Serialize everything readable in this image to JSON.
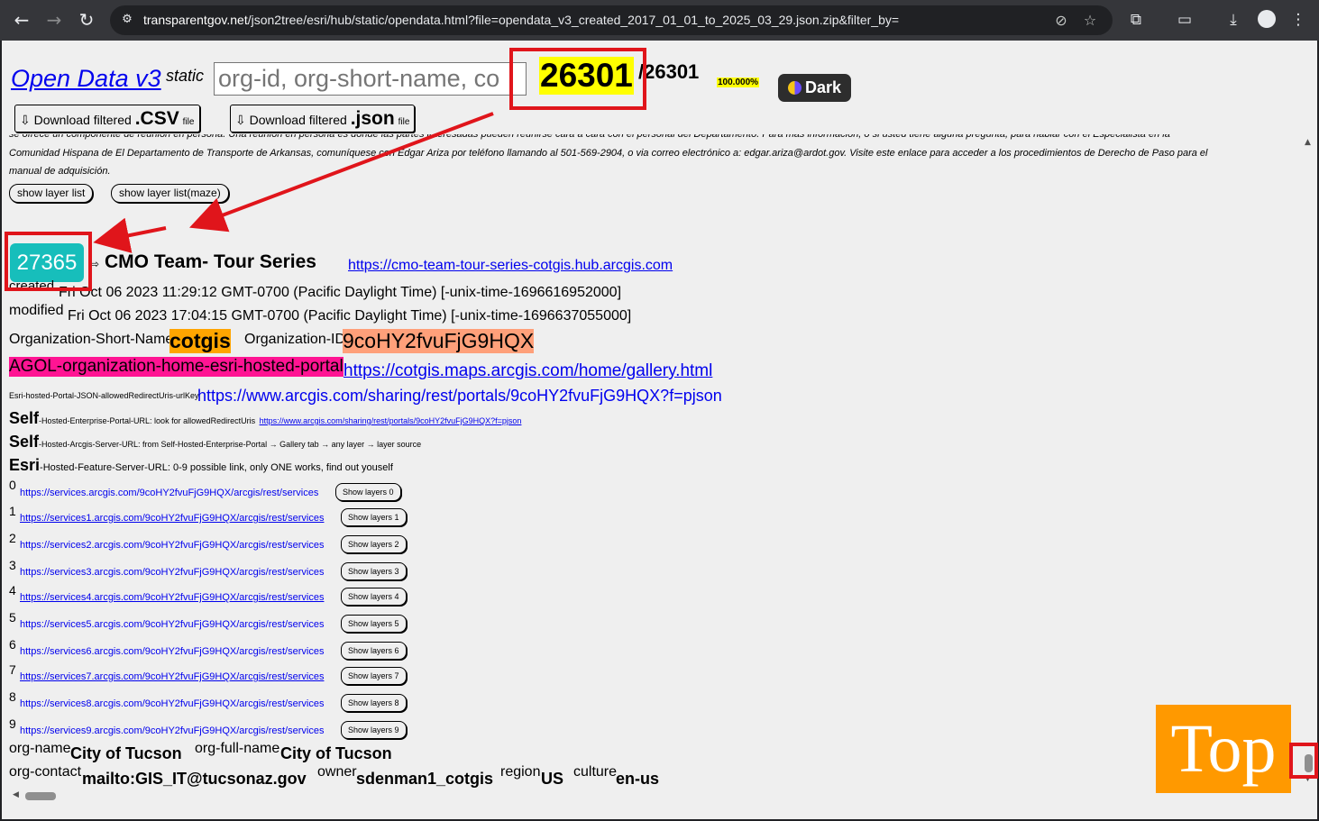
{
  "browser": {
    "url_host": "transparentgov.net",
    "url_path": "/json2tree/esri/hub/static/opendata.html?file=opendata_v3_created_2017_01_01_to_2025_03_29.json.zip&filter_by="
  },
  "header": {
    "title": "Open Data v3",
    "title_suffix": "static",
    "search_placeholder": "org-id, org-short-name, co",
    "filtered_count": "26301",
    "total_count": "/26301",
    "percent": "100.000%",
    "dark_label": "Dark",
    "download_csv_prefix": "⇩ Download filtered ",
    "download_csv_ext": ".CSV",
    "download_json_prefix": "⇩ Download filtered ",
    "download_json_ext": ".json",
    "download_file_suffix": "file"
  },
  "description": {
    "line1": "se ofrece un componente de reunión en persona. Una reunión en persona es donde las partes interesadas pueden reunirse cara a cara con el personal del Departamento. Para más información, o si usted tiene alguna pregunta, para hablar con el Especialista en la",
    "line2": "Comunidad Hispana de El Departamento de Transporte de Arkansas, comuníquese con Edgar Ariza por teléfono llamando al 501-569-2904,  o via correo electrónico a: edgar.ariza@ardot.gov. Visite este enlace para acceder a los procedimientos de Derecho de Paso para el",
    "line3": "manual de adquisición.",
    "show_layer_list": "show layer list",
    "show_layer_list_maze": "show layer list(maze)"
  },
  "record": {
    "index": "27365",
    "arrow": "⇨",
    "title": "CMO Team- Tour Series",
    "url": "https://cmo-team-tour-series-cotgis.hub.arcgis.com",
    "created_label": "created",
    "created_value": "Fri Oct 06 2023 11:29:12 GMT-0700 (Pacific Daylight Time) [-unix-time-1696616952000]",
    "modified_label": "modified",
    "modified_value": "Fri Oct 06 2023 17:04:15 GMT-0700 (Pacific Daylight Time) [-unix-time-1696637055000]",
    "org_short_name_label": "Organization-Short-Name",
    "org_short_name": "cotgis",
    "org_id_label": "Organization-ID",
    "org_id": "9coHY2fvuFjG9HQX",
    "agol_label": "AGOL-organization-home-esri-hosted-portal",
    "agol_url": "https://cotgis.maps.arcgis.com/home/gallery.html",
    "redirect_label": "Esri-hosted-Portal-JSON-allowedRedirectUris-urlKey",
    "redirect_url": "https://www.arcgis.com/sharing/rest/portals/9coHY2fvuFjG9HQX?f=pjson",
    "self1_bold": "Self",
    "self1_text": "-Hosted-Enterprise-Portal-URL: look for allowedRedirectUris",
    "self1_link": "https://www.arcgis.com/sharing/rest/portals/9coHY2fvuFjG9HQX?f=pjson",
    "self2_bold": "Self",
    "self2_text": "-Hosted-Arcgis-Server-URL: from Self-Hosted-Enterprise-Portal → Gallery tab → any layer → layer source",
    "esri_bold": "Esri",
    "esri_text": "-Hosted-Feature-Server-URL: 0-9 possible link, only ONE works, find out youself",
    "services": [
      {
        "num": "0",
        "url": "https://services.arcgis.com/9coHY2fvuFjG9HQX/arcgis/rest/services",
        "button": "Show layers 0"
      },
      {
        "num": "1",
        "url": "https://services1.arcgis.com/9coHY2fvuFjG9HQX/arcgis/rest/services",
        "button": "Show layers 1"
      },
      {
        "num": "2",
        "url": "https://services2.arcgis.com/9coHY2fvuFjG9HQX/arcgis/rest/services",
        "button": "Show layers 2"
      },
      {
        "num": "3",
        "url": "https://services3.arcgis.com/9coHY2fvuFjG9HQX/arcgis/rest/services",
        "button": "Show layers 3"
      },
      {
        "num": "4",
        "url": "https://services4.arcgis.com/9coHY2fvuFjG9HQX/arcgis/rest/services",
        "button": "Show layers 4"
      },
      {
        "num": "5",
        "url": "https://services5.arcgis.com/9coHY2fvuFjG9HQX/arcgis/rest/services",
        "button": "Show layers 5"
      },
      {
        "num": "6",
        "url": "https://services6.arcgis.com/9coHY2fvuFjG9HQX/arcgis/rest/services",
        "button": "Show layers 6"
      },
      {
        "num": "7",
        "url": "https://services7.arcgis.com/9coHY2fvuFjG9HQX/arcgis/rest/services",
        "button": "Show layers 7"
      },
      {
        "num": "8",
        "url": "https://services8.arcgis.com/9coHY2fvuFjG9HQX/arcgis/rest/services",
        "button": "Show layers 8"
      },
      {
        "num": "9",
        "url": "https://services9.arcgis.com/9coHY2fvuFjG9HQX/arcgis/rest/services",
        "button": "Show layers 9"
      }
    ],
    "org_name_label": "org-name",
    "org_name": "City of Tucson",
    "org_full_name_label": "org-full-name",
    "org_full_name": "City of Tucson",
    "org_contact_label": "org-contact",
    "org_contact": "mailto:GIS_IT@tucsonaz.gov",
    "owner_label": "owner",
    "owner": "sdenman1_cotgis",
    "region_label": "region",
    "region": "US",
    "culture_label": "culture",
    "culture": "en-us"
  },
  "top_button": "Top",
  "colors": {
    "annotation_red": "#e0151b",
    "badge_teal": "#17bebb",
    "highlight_yellow": "#ffff00",
    "highlight_orange": "#ffa500",
    "highlight_salmon": "#ffa07a",
    "highlight_pink": "#ff1493",
    "top_orange": "#ff9900"
  }
}
